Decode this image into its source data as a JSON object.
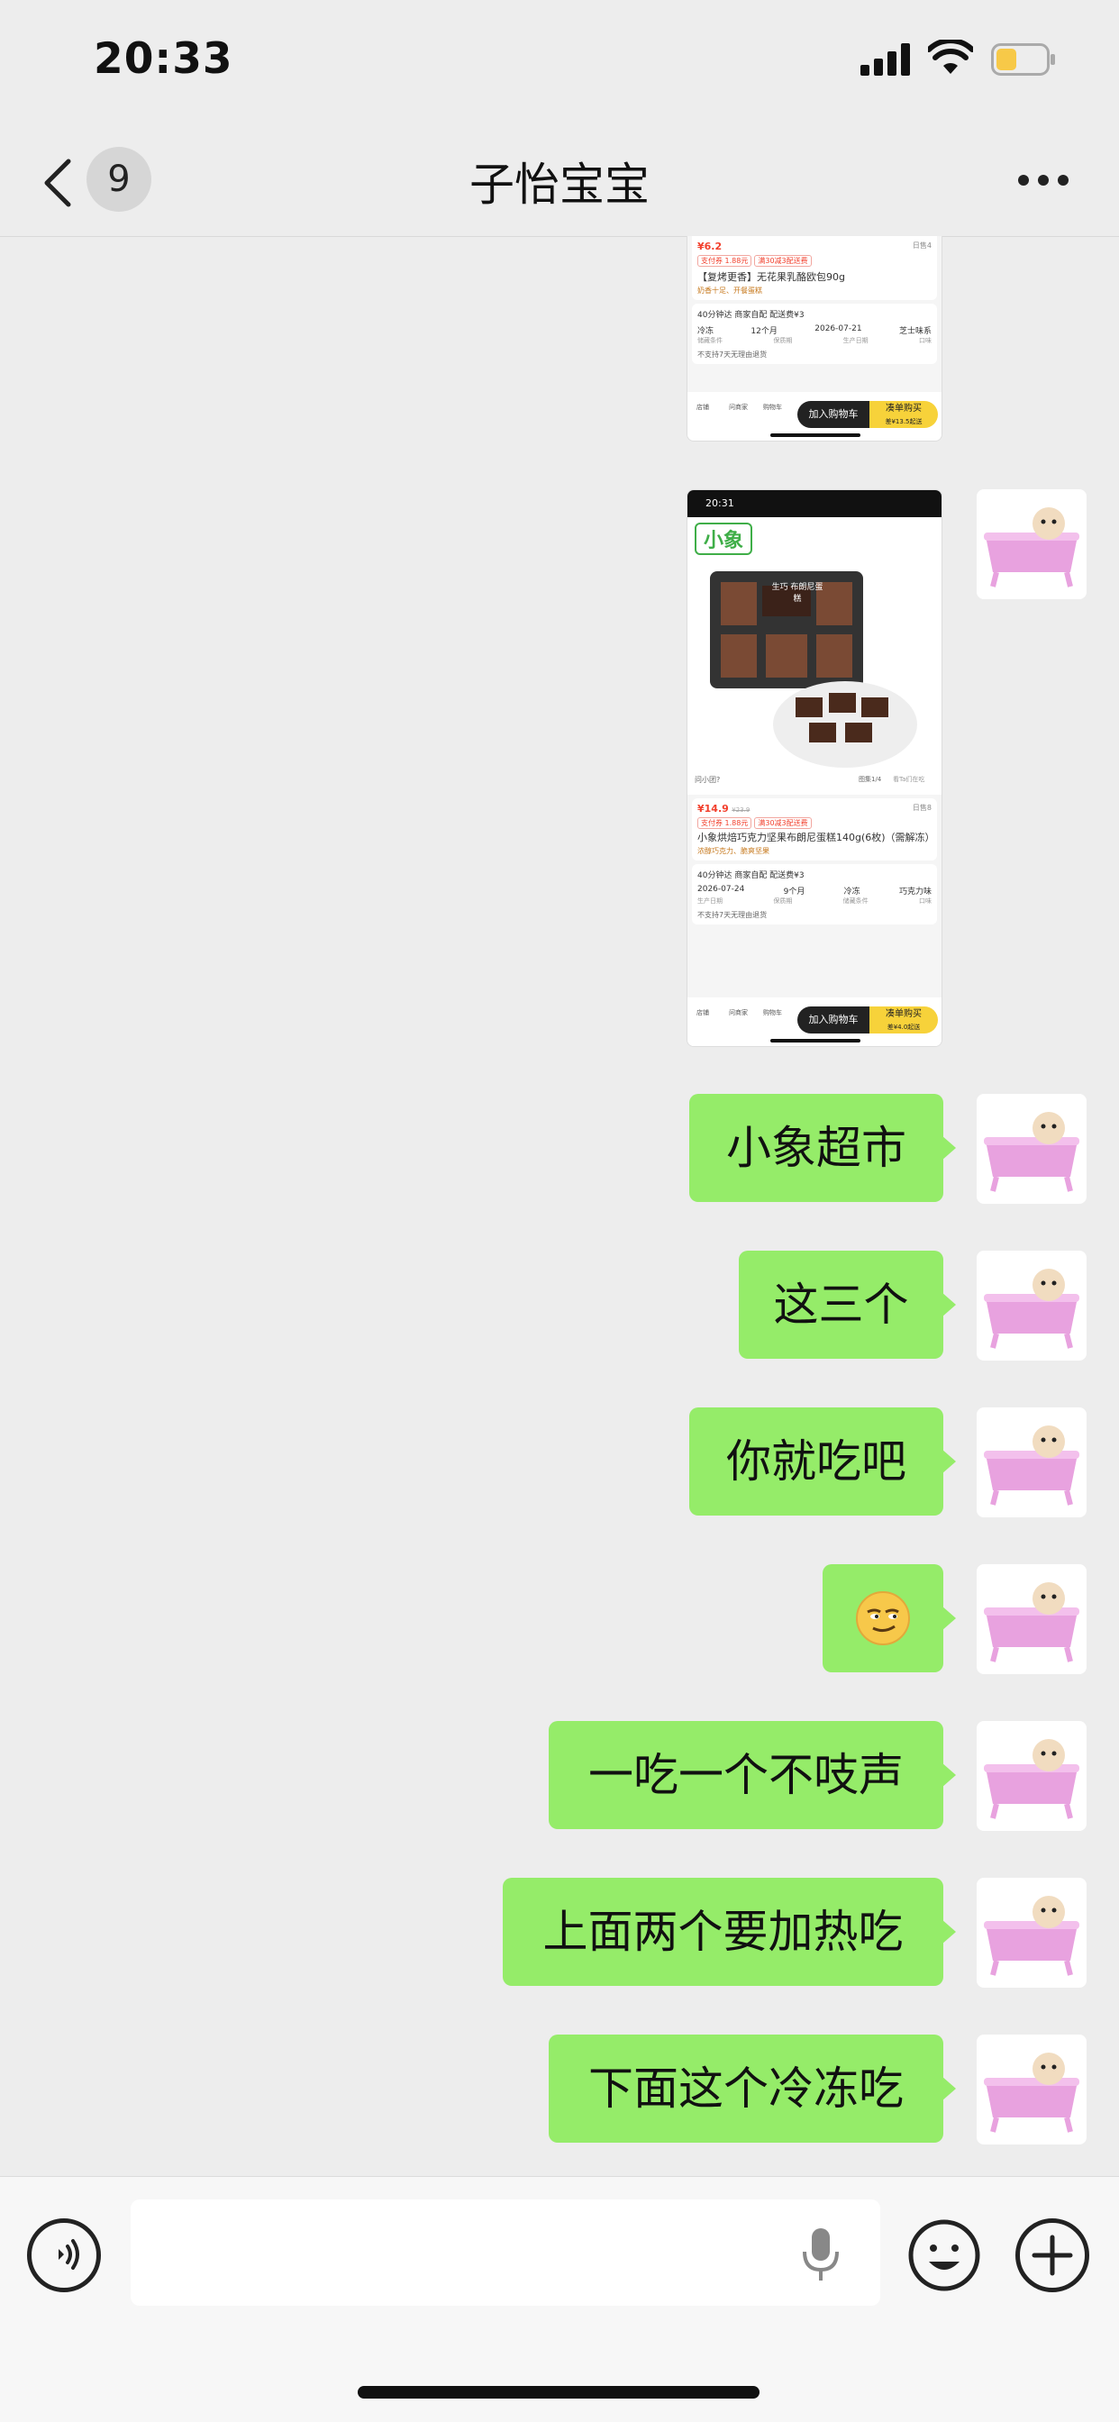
{
  "status_bar": {
    "time": "20:33",
    "battery_color": "#f7c948"
  },
  "nav": {
    "back_count": "9",
    "title": "子怡宝宝"
  },
  "screenshot_1": {
    "price": "¥6.2",
    "tags": [
      "支付券 1.88元",
      "满30减3配送费"
    ],
    "period": "日售4",
    "product": "【复烤更香】无花果乳酪欧包90g",
    "sub_tag": "奶香十足、开餐蛋糕",
    "delivery": "40分钟达  商家自配  配送费¥3",
    "specs": [
      "冷冻",
      "12个月",
      "2026-07-21",
      "芝士味系"
    ],
    "spec_labels": [
      "储藏条件",
      "保质期",
      "生产日期",
      "口味"
    ],
    "notice": "不支持7天无理由退货",
    "nav_items": [
      "店铺",
      "问商家",
      "购物车"
    ],
    "cart_label": "加入购物车",
    "buy_label": "凑单购买",
    "buy_sub": "差¥13.5起送"
  },
  "screenshot_2": {
    "time": "20:31",
    "brand": "小象",
    "box_label": "生巧 布朗尼蛋糕",
    "ask_label": "问小团?",
    "image_index": "图集1/4",
    "image_share": "看Ta们在吃",
    "price": "¥14.9",
    "original_price": "¥23.9",
    "tags": [
      "支付券 1.88元",
      "满30减3配送费"
    ],
    "period": "日售8",
    "product": "小象烘焙巧克力坚果布朗尼蛋糕140g(6枚)（需解冻）",
    "sub_tag": "浓醇巧克力、脆爽坚果",
    "delivery": "40分钟达  商家自配  配送费¥3",
    "specs": [
      "2026-07-24",
      "9个月",
      "冷冻",
      "巧克力味"
    ],
    "spec_labels": [
      "生产日期",
      "保质期",
      "储藏条件",
      "口味"
    ],
    "notice": "不支持7天无理由退货",
    "nav_items": [
      "店铺",
      "问商家",
      "购物车"
    ],
    "cart_label": "加入购物车",
    "buy_label": "凑单购买",
    "buy_sub": "差¥4.0起送"
  },
  "messages": [
    {
      "text": "小象超市"
    },
    {
      "text": "这三个"
    },
    {
      "text": "你就吃吧"
    },
    {
      "text": "😏",
      "icon": "smirk-emoji"
    },
    {
      "text": "一吃一个不吱声"
    },
    {
      "text": "上面两个要加热吃"
    },
    {
      "text": "下面这个冷冻吃"
    }
  ],
  "input": {
    "value": ""
  },
  "colors": {
    "bubble": "#95ec69",
    "background": "#ededed"
  }
}
